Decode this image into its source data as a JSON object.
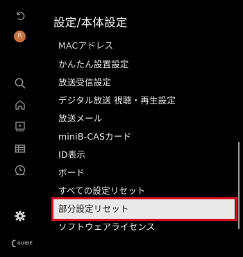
{
  "header": {
    "title": "設定/本体設定"
  },
  "sidebar": {
    "avatar_initial": "R",
    "icons": [
      "back-icon",
      "avatar",
      "search-icon",
      "home-icon",
      "recordings-icon",
      "program-guide-icon",
      "timer-icon",
      "gear-icon"
    ],
    "logo_text": "GUIDE"
  },
  "menu": {
    "items": [
      {
        "label": "MACアドレス",
        "state": "partially-hidden"
      },
      {
        "label": "かんたん設置設定",
        "state": "normal"
      },
      {
        "label": "放送受信設定",
        "state": "normal"
      },
      {
        "label": "デジタル放送 視聴・再生設定",
        "state": "normal"
      },
      {
        "label": "放送メール",
        "state": "normal"
      },
      {
        "label": "miniB-CASカード",
        "state": "normal"
      },
      {
        "label": "ID表示",
        "state": "normal"
      },
      {
        "label": "ボード",
        "state": "normal"
      },
      {
        "label": "すべての設定リセット",
        "state": "normal"
      },
      {
        "label": "部分設定リセット",
        "state": "selected"
      },
      {
        "label": "ソフトウェアライセンス",
        "state": "normal"
      }
    ]
  },
  "colors": {
    "background": "#000000",
    "text": "#e8e8e8",
    "selected_background": "#e9e9e9",
    "highlight_frame": "#d9121f",
    "avatar": "#c9703f"
  }
}
